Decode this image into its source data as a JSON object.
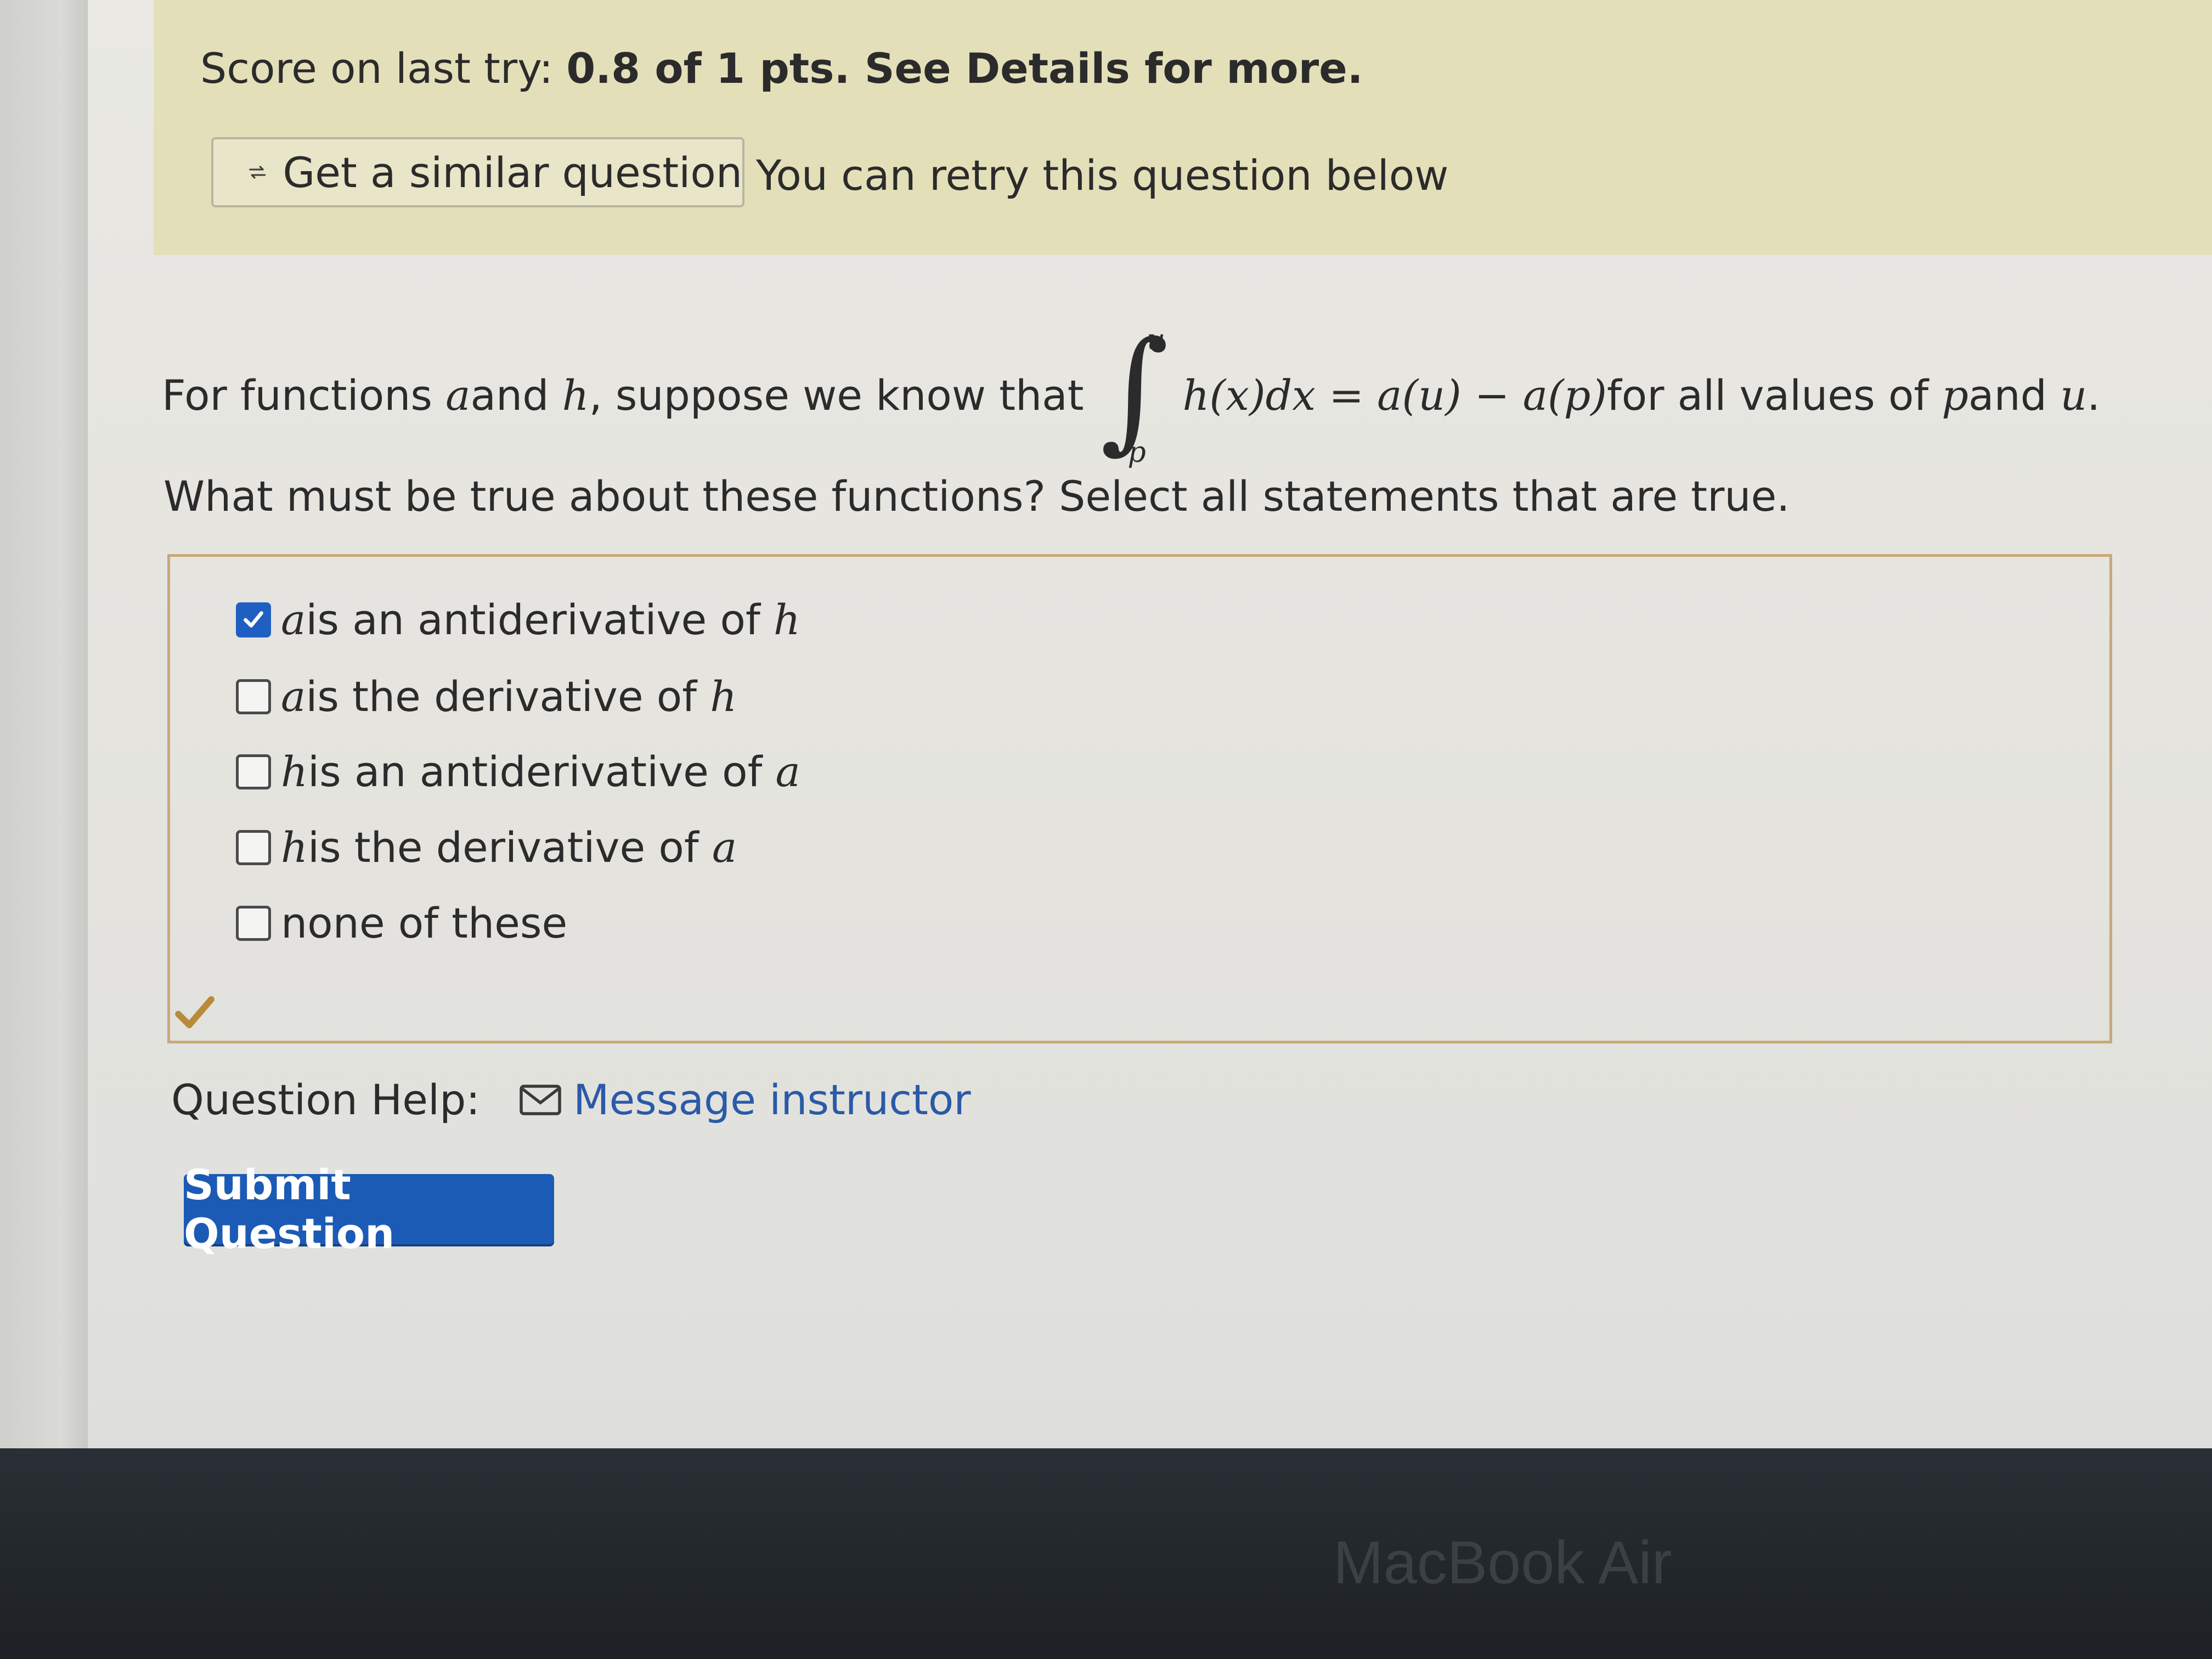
{
  "banner": {
    "score_prefix": "Score on last try: ",
    "score_value": "0.8 of 1 pts",
    "score_suffix": ". See Details for more.",
    "similar_button_label": "Get a similar question",
    "retry_text": "You can retry this question below"
  },
  "question": {
    "intro": "For functions ",
    "var_a": "a",
    "and_text": " and ",
    "var_h": "h",
    "suppose_text": ", suppose we know that",
    "integral_upper": "u",
    "integral_lower": "p",
    "equation": "h(x)dx = a(u) − a(p)",
    "tail_text": " for all values of ",
    "var_p": "p",
    "and_text2": " and ",
    "var_u": "u",
    "period": ".",
    "prompt": "What must be true about these functions? Select all statements that are true."
  },
  "options": [
    {
      "var1": "a",
      "text": " is an antiderivative of ",
      "var2": "h",
      "checked": true
    },
    {
      "var1": "a",
      "text": " is the derivative of ",
      "var2": "h",
      "checked": false
    },
    {
      "var1": "h",
      "text": " is an antiderivative of ",
      "var2": "a",
      "checked": false
    },
    {
      "var1": "h",
      "text": " is the derivative of ",
      "var2": "a",
      "checked": false
    },
    {
      "text": "none of these",
      "checked": false
    }
  ],
  "help": {
    "label": "Question Help:",
    "message_link": "Message instructor"
  },
  "submit_label": "Submit Question",
  "device_label": "MacBook Air",
  "colors": {
    "banner_bg": "#e3dfb9",
    "submit_bg": "#1c5bb5",
    "checkbox_checked": "#1f5fc2",
    "options_border": "#c9a878",
    "correct_mark": "#b88a3a"
  }
}
